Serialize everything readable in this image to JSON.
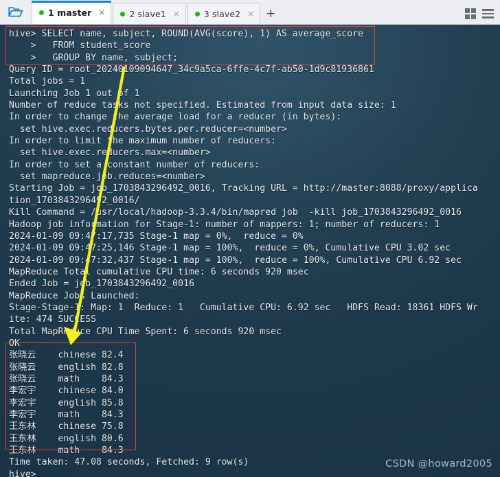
{
  "window": {
    "folder_icon": "open-folder-icon",
    "add_tab_label": "+",
    "grid_icon": "grid-view-icon",
    "menu_icon": "hamburger-menu-icon"
  },
  "tabs": [
    {
      "label": "1 master",
      "active": true,
      "status_dot": "#22b417",
      "close": "×"
    },
    {
      "label": "2 slave1",
      "active": false,
      "status_dot": "#22b417",
      "close": "×"
    },
    {
      "label": "3 slave2",
      "active": false,
      "status_dot": "#22b417",
      "close": "×"
    }
  ],
  "terminal": {
    "background_color": "#21405a",
    "text_color": "#e8eef2",
    "lines": [
      "hive> SELECT name, subject, ROUND(AVG(score), 1) AS average_score",
      "    >   FROM student_score",
      "    >   GROUP BY name, subject;",
      "Query ID = root_20240109094647_34c9a5ca-6ffe-4c7f-ab50-1d9c81936861",
      "Total jobs = 1",
      "Launching Job 1 out of 1",
      "Number of reduce tasks not specified. Estimated from input data size: 1",
      "In order to change the average load for a reducer (in bytes):",
      "  set hive.exec.reducers.bytes.per.reducer=<number>",
      "In order to limit the maximum number of reducers:",
      "  set hive.exec.reducers.max=<number>",
      "In order to set a constant number of reducers:",
      "  set mapreduce.job.reduces=<number>",
      "Starting Job = job_1703843296492_0016, Tracking URL = http://master:8088/proxy/applica",
      "tion_1703843296492_0016/",
      "Kill Command = /usr/local/hadoop-3.3.4/bin/mapred job  -kill job_1703843296492_0016",
      "Hadoop job information for Stage-1: number of mappers: 1; number of reducers: 1",
      "2024-01-09 09:47:17,735 Stage-1 map = 0%,  reduce = 0%",
      "2024-01-09 09:47:25,146 Stage-1 map = 100%,  reduce = 0%, Cumulative CPU 3.02 sec",
      "2024-01-09 09:47:32,437 Stage-1 map = 100%,  reduce = 100%, Cumulative CPU 6.92 sec",
      "MapReduce Total cumulative CPU time: 6 seconds 920 msec",
      "Ended Job = job_1703843296492_0016",
      "MapReduce Jobs Launched:",
      "Stage-Stage-1: Map: 1  Reduce: 1   Cumulative CPU: 6.92 sec   HDFS Read: 18361 HDFS Wr",
      "ite: 474 SUCCESS",
      "Total MapReduce CPU Time Spent: 6 seconds 920 msec",
      "OK",
      "张晓云\t chinese 82.4",
      "张晓云\t english 82.8",
      "张晓云\t math    84.3",
      "李宏宇\t chinese 84.0",
      "李宏宇\t english 85.8",
      "李宏宇\t math    84.3",
      "王东林\t chinese 75.8",
      "王东林\t english 80.6",
      "王东林\t math    84.3",
      "Time taken: 47.08 seconds, Fetched: 9 row(s)",
      "hive>"
    ]
  },
  "query_result": {
    "columns": [
      "name",
      "subject",
      "average_score"
    ],
    "rows": [
      {
        "name": "张晓云",
        "subject": "chinese",
        "average_score": 82.4
      },
      {
        "name": "张晓云",
        "subject": "english",
        "average_score": 82.8
      },
      {
        "name": "张晓云",
        "subject": "math",
        "average_score": 84.3
      },
      {
        "name": "李宏宇",
        "subject": "chinese",
        "average_score": 84.0
      },
      {
        "name": "李宏宇",
        "subject": "english",
        "average_score": 85.8
      },
      {
        "name": "李宏宇",
        "subject": "math",
        "average_score": 84.3
      },
      {
        "name": "王东林",
        "subject": "chinese",
        "average_score": 75.8
      },
      {
        "name": "王东林",
        "subject": "english",
        "average_score": 80.6
      },
      {
        "name": "王东林",
        "subject": "math",
        "average_score": 84.3
      }
    ],
    "row_count": 9,
    "time_taken_seconds": 47.08
  },
  "annotations": {
    "box_color": "#ef3b35",
    "arrow_color": "#f2ef1d",
    "query_box_label": "sql-query-highlight",
    "result_box_label": "query-result-highlight"
  },
  "watermark": {
    "text": "CSDN @howard2005"
  }
}
